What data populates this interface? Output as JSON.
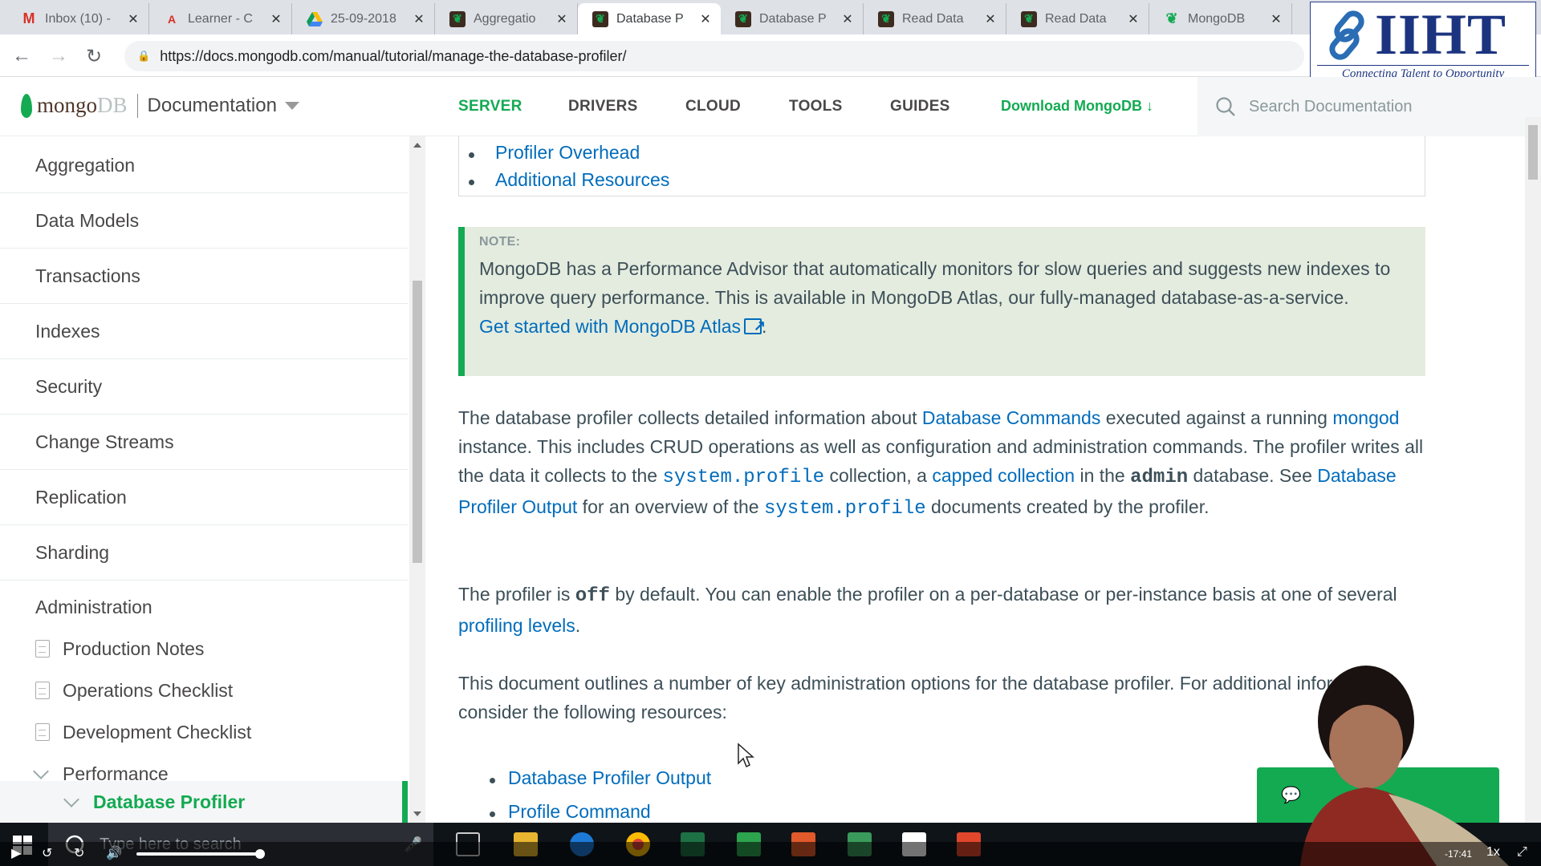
{
  "browser": {
    "tabs": [
      {
        "title": "Inbox (10) -",
        "icon": "gmail-icon"
      },
      {
        "title": "Learner - C",
        "icon": "acrobat-icon"
      },
      {
        "title": "25-09-2018",
        "icon": "drive-icon"
      },
      {
        "title": "Aggregatio",
        "icon": "mongodb-leaf-icon"
      },
      {
        "title": "Database P",
        "icon": "mongodb-leaf-icon"
      },
      {
        "title": "Database P",
        "icon": "mongodb-leaf-icon"
      },
      {
        "title": "Read Data",
        "icon": "mongodb-leaf-icon"
      },
      {
        "title": "Read Data",
        "icon": "mongodb-leaf-icon"
      },
      {
        "title": "MongoDB",
        "icon": "mongodb-leaf-icon"
      }
    ],
    "active_tab": 4,
    "url": "https://docs.mongodb.com/manual/tutorial/manage-the-database-profiler/"
  },
  "watermark": {
    "name": "IIHT",
    "tagline": "Connecting Talent to Opportunity"
  },
  "header": {
    "logo_mongo": "mongo",
    "logo_db": "DB",
    "section": "Documentation",
    "nav": [
      "SERVER",
      "DRIVERS",
      "CLOUD",
      "TOOLS",
      "GUIDES"
    ],
    "nav_active": "SERVER",
    "download": "Download MongoDB ↓",
    "search_placeholder": "Search Documentation"
  },
  "sidebar": {
    "items": [
      "Aggregation",
      "Data Models",
      "Transactions",
      "Indexes",
      "Security",
      "Change Streams",
      "Replication",
      "Sharding"
    ],
    "administration": "Administration",
    "sub_items": [
      "Production Notes",
      "Operations Checklist",
      "Development Checklist"
    ],
    "performance": "Performance",
    "active": "Database Profiler"
  },
  "content": {
    "toc": [
      "Profiler Overhead",
      "Additional Resources"
    ],
    "note": {
      "label": "NOTE:",
      "text": "MongoDB has a Performance Advisor that automatically monitors for slow queries and suggests new indexes to improve query performance. This is available in MongoDB Atlas, our fully-managed database-as-a-service.",
      "link": "Get started with MongoDB Atlas"
    },
    "p1": {
      "t1": "The database profiler collects detailed information about ",
      "l1": "Database Commands",
      "t2": " executed against a running ",
      "l2": "mongod",
      "t3": " instance. This includes CRUD operations as well as configuration and administration commands. The profiler writes all the data it collects to the ",
      "c1": "system.profile",
      "t4": " collection, a ",
      "l3": "capped collection",
      "t5": " in the ",
      "c2": "admin",
      "t6": " database. See ",
      "l4": "Database Profiler Output",
      "t7": " for an overview of the ",
      "c3": "system.profile",
      "t8": " documents created by the profiler."
    },
    "p2": {
      "t1": "The profiler is ",
      "c1": "off",
      "t2": " by default. You can enable the profiler on a per-database or per-instance basis at one of several ",
      "l1": "profiling levels",
      "t3": "."
    },
    "p3": "This document outlines a number of key administration options for the database profiler. For additional information, consider the following resources:",
    "resources": [
      "Database Profiler Output",
      "Profile Command"
    ]
  },
  "taskbar": {
    "search_placeholder": "Type here to search"
  },
  "player": {
    "time": "-17:41",
    "speed": "1x",
    "progress": 0.13
  }
}
